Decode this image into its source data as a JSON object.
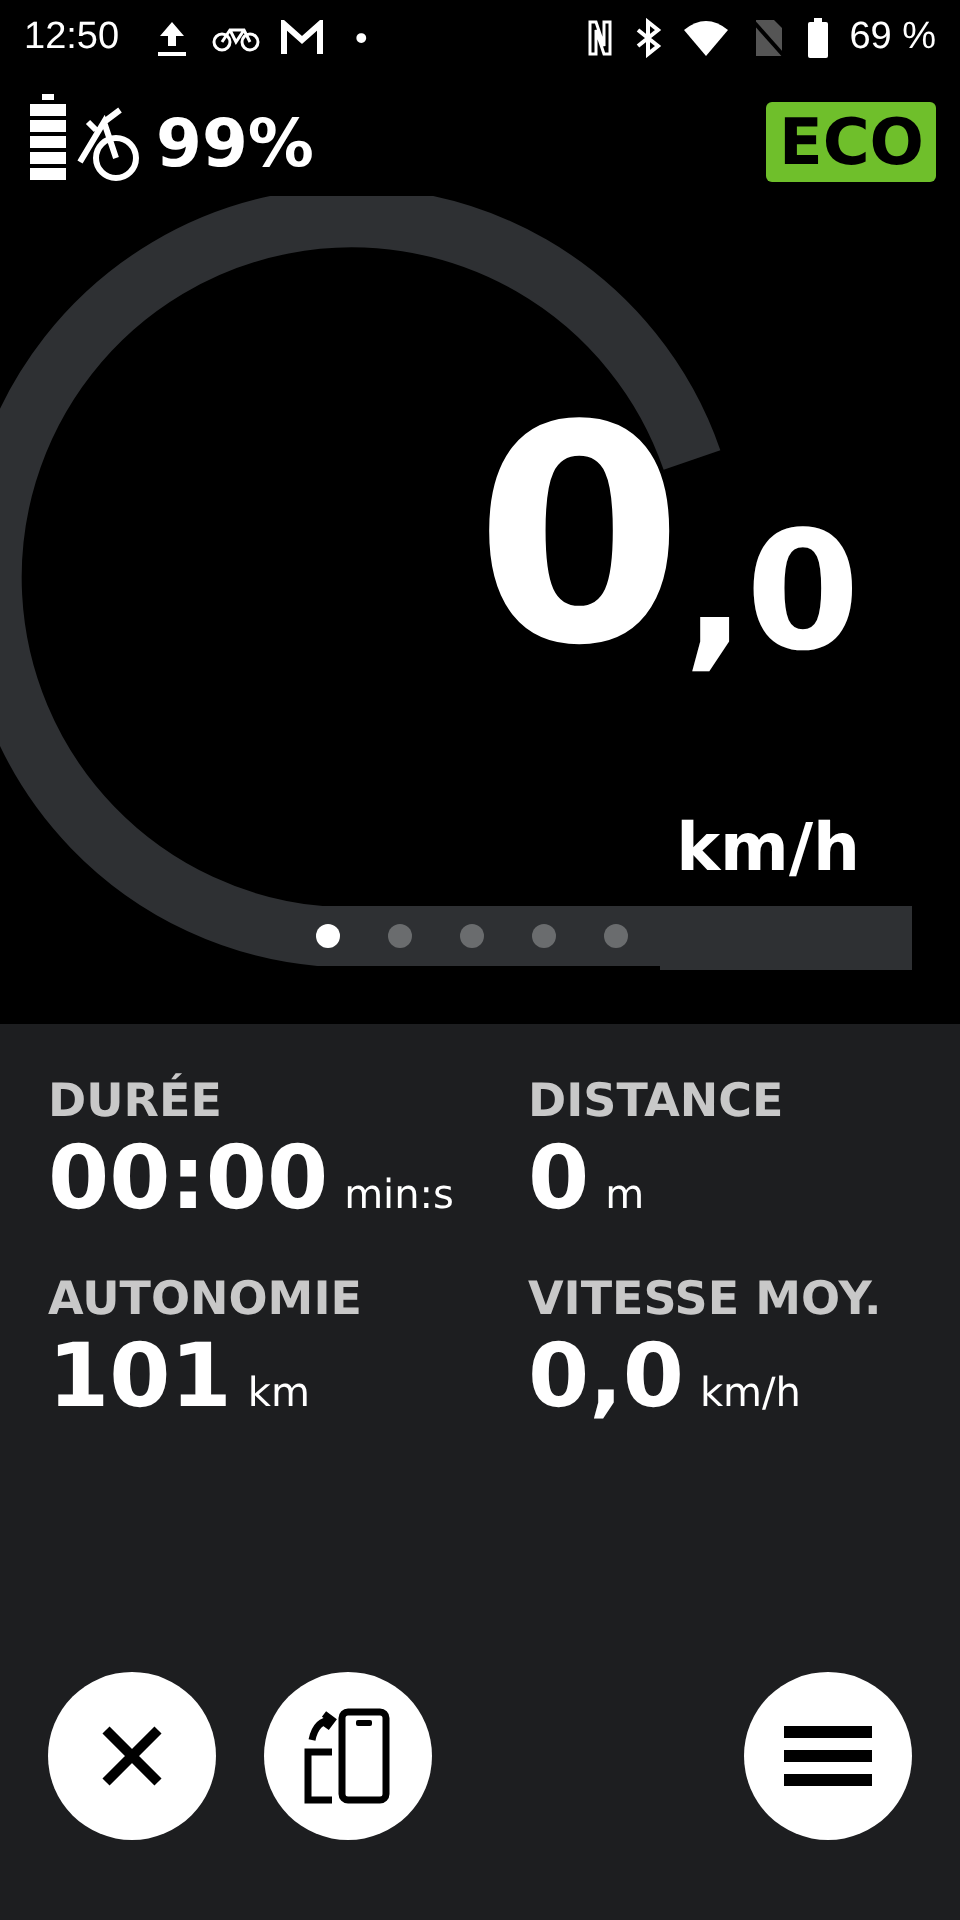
{
  "status_bar": {
    "time": "12:50",
    "notification_dot": "•",
    "battery": "69 %"
  },
  "header": {
    "bike_battery": "99%",
    "mode": "ECO"
  },
  "speed": {
    "integer": "0",
    "decimal": ",0",
    "unit": "km/h"
  },
  "pager": [
    {
      "selected": true
    },
    {
      "selected": false
    },
    {
      "selected": false
    },
    {
      "selected": false
    },
    {
      "selected": false
    }
  ],
  "stats": [
    {
      "label": "DURÉE",
      "value": "00:00",
      "unit": "min:s"
    },
    {
      "label": "DISTANCE",
      "value": "0",
      "unit": "m"
    },
    {
      "label": "AUTONOMIE",
      "value": "101",
      "unit": "km"
    },
    {
      "label": "VITESSE MOY.",
      "value": "0,0",
      "unit": "km/h"
    }
  ]
}
